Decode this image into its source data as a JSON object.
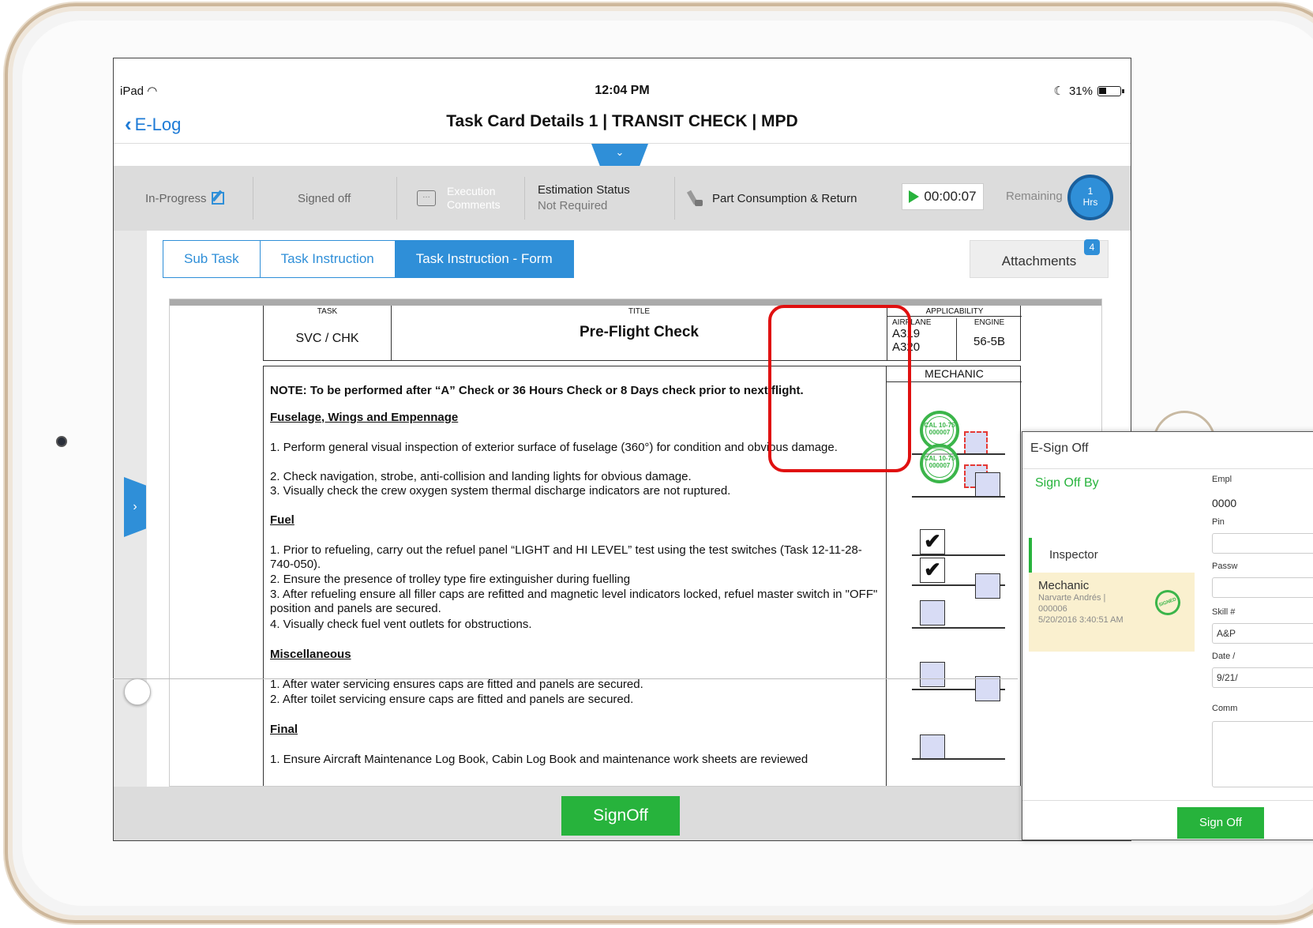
{
  "device": {
    "carrier": "iPad",
    "time": "12:04 PM",
    "battery": "31%"
  },
  "nav": {
    "back_label": "E-Log",
    "title": "Task Card Details   1 | TRANSIT CHECK | MPD"
  },
  "toolbar": {
    "status_in_progress": "In-Progress",
    "status_signed_off": "Signed off",
    "execution_comments": "Execution Comments",
    "estimation_status_label": "Estimation Status",
    "estimation_status_value": "Not Required",
    "part_consumption": "Part Consumption & Return",
    "timer": "00:00:07",
    "remaining_label": "Remaining",
    "hours_value": "1",
    "hours_unit": "Hrs"
  },
  "tabs": [
    {
      "label": "Sub Task",
      "active": false
    },
    {
      "label": "Task Instruction",
      "active": false
    },
    {
      "label": "Task Instruction - Form",
      "active": true
    }
  ],
  "attachments": {
    "label": "Attachments",
    "count": "4"
  },
  "document": {
    "header": {
      "task_label": "TASK",
      "task_value": "SVC / CHK",
      "title_label": "TITLE",
      "title_value": "Pre-Flight Check",
      "applicability_label": "APPLICABILITY",
      "airplane_label": "AIRPLANE",
      "engine_label": "ENGINE",
      "airplane_1": "A319",
      "airplane_2": "A320",
      "engine_value": "56-5B"
    },
    "mechanic_label": "MECHANIC",
    "note": "NOTE: To be performed after “A” Check or 36 Hours Check or 8 Days check prior to next flight.",
    "sections": {
      "fuselage": {
        "title": "Fuselage, Wings and Empennage",
        "items": [
          "1.    Perform general visual inspection of exterior surface of fuselage (360°) for condition and obvious damage.",
          "2.    Check navigation, strobe, anti-collision and landing lights for obvious damage.",
          "3.    Visually check the crew oxygen system thermal discharge indicators are not ruptured."
        ]
      },
      "fuel": {
        "title": "Fuel",
        "items": [
          "1.    Prior to refueling, carry out the refuel panel “LIGHT and HI LEVEL” test using the test switches (Task 12-11-28-740-050).",
          "2.    Ensure the presence of trolley type fire extinguisher during fuelling",
          "3.    After refueling ensure all filler caps are refitted and magnetic level indicators locked, refuel master switch in \"OFF\" position and panels are secured.",
          "4.    Visually check fuel vent outlets for obstructions."
        ]
      },
      "misc": {
        "title": "Miscellaneous",
        "items": [
          "1.    After water servicing ensures caps are fitted and panels are secured.",
          "2.    After toilet servicing ensure caps are fitted and panels are secured."
        ]
      },
      "final": {
        "title": "Final",
        "items": [
          "1.    Ensure Aircraft Maintenance Log Book, Cabin Log Book and maintenance work sheets are reviewed"
        ]
      }
    },
    "stamp_text": "CAL 10-75 000007",
    "check_mark": "✔"
  },
  "footer": {
    "signoff_label": "SignOff"
  },
  "esign": {
    "title": "E-Sign Off",
    "sign_off_by": "Sign Off By",
    "inspector": "Inspector",
    "mechanic": {
      "role": "Mechanic",
      "name": "Narvarte Andrés  |",
      "id": "000006",
      "datetime": "5/20/2016 3:40:51 AM",
      "stamp_text": "SIGNED"
    },
    "employee_label": "Empl",
    "employee_value": "0000",
    "pin_label": "Pin",
    "password_label": "Passw",
    "skill_label": "Skill #",
    "skill_value": "A&P",
    "date_label": "Date /",
    "date_value": "9/21/",
    "comments_label": "Comm",
    "button_label": "Sign Off"
  },
  "colors": {
    "accent": "#2f8fd8",
    "green": "#27b33c",
    "highlight_red": "#e01010",
    "toolbar_bg": "#dcdcdc"
  }
}
